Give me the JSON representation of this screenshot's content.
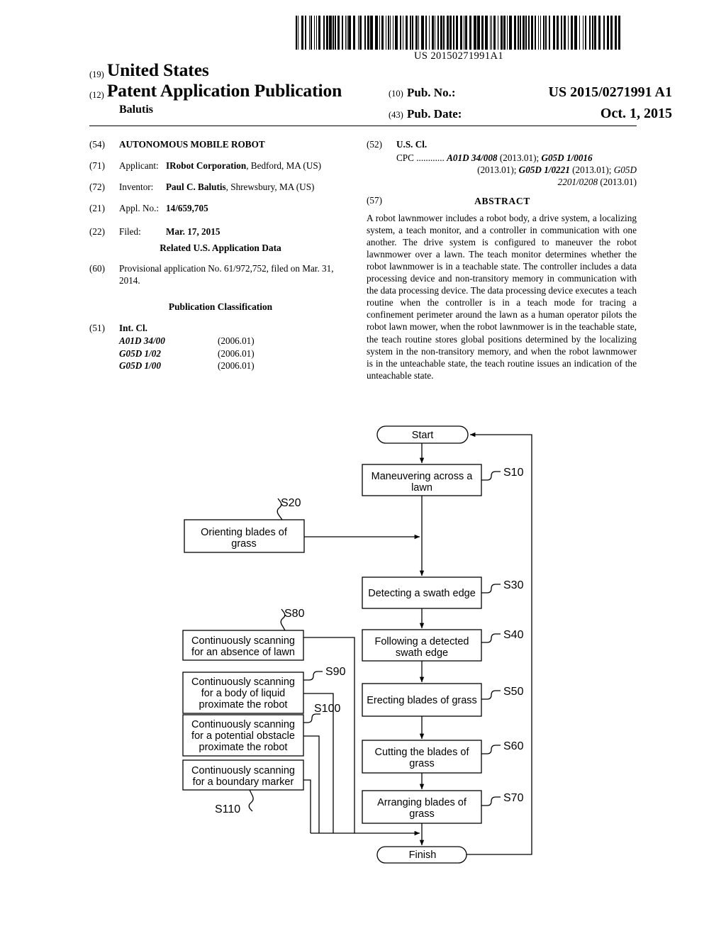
{
  "header": {
    "barcode_number": "US 20150271991A1",
    "code_19": "(19)",
    "country": "United States",
    "code_12": "(12)",
    "doc_type": "Patent Application Publication",
    "author": "Balutis",
    "code_10": "(10)",
    "pub_no_label": "Pub. No.:",
    "pub_no_value": "US 2015/0271991 A1",
    "code_43": "(43)",
    "pub_date_label": "Pub. Date:",
    "pub_date_value": "Oct. 1, 2015"
  },
  "left_column": {
    "title_code": "(54)",
    "title": "AUTONOMOUS MOBILE ROBOT",
    "applicant_code": "(71)",
    "applicant_label": "Applicant:",
    "applicant_name": "IRobot Corporation",
    "applicant_rest": ", Bedford, MA (US)",
    "inventor_code": "(72)",
    "inventor_label": "Inventor:",
    "inventor_name": "Paul C. Balutis",
    "inventor_rest": ", Shrewsbury, MA (US)",
    "appl_no_code": "(21)",
    "appl_no_label": "Appl. No.:",
    "appl_no_value": "14/659,705",
    "filed_code": "(22)",
    "filed_label": "Filed:",
    "filed_value": "Mar. 17, 2015",
    "related_heading": "Related U.S. Application Data",
    "provisional_code": "(60)",
    "provisional_text": "Provisional application No. 61/972,752, filed on Mar. 31, 2014.",
    "classification_heading": "Publication Classification",
    "intcl_code": "(51)",
    "intcl_label": "Int. Cl.",
    "intcl_rows": [
      {
        "classification": "A01D 34/00",
        "version": "(2006.01)"
      },
      {
        "classification": "G05D 1/02",
        "version": "(2006.01)"
      },
      {
        "classification": "G05D 1/00",
        "version": "(2006.01)"
      }
    ]
  },
  "right_column": {
    "uscl_code": "(52)",
    "uscl_label": "U.S. Cl.",
    "cpc_prefix": "CPC ............",
    "cpc_line1_a": "A01D 34/008",
    "cpc_line1_b": " (2013.01); ",
    "cpc_line1_c": "G05D 1/0016",
    "cpc_line2_a": "(2013.01); ",
    "cpc_line2_b": "G05D 1/0221",
    "cpc_line2_c": " (2013.01); ",
    "cpc_line2_d": "G05D",
    "cpc_line3_a": "2201/0208",
    "cpc_line3_b": " (2013.01)",
    "abstract_code": "(57)",
    "abstract_title": "ABSTRACT",
    "abstract_text": "A robot lawnmower includes a robot body, a drive system, a localizing system, a teach monitor, and a controller in communication with one another. The drive system is configured to maneuver the robot lawnmower over a lawn. The teach monitor determines whether the robot lawnmower is in a teachable state. The controller includes a data processing device and non-transitory memory in communication with the data processing device. The data processing device executes a teach routine when the controller is in a teach mode for tracing a confinement perimeter around the lawn as a human operator pilots the robot lawn mower, when the robot lawnmower is in the teachable state, the teach routine stores global positions determined by the localizing system in the non-transitory memory, and when the robot lawnmower is in the unteachable state, the teach routine issues an indication of the unteachable state."
  },
  "flowchart": {
    "start_label": "Start",
    "finish_label": "Finish",
    "nodes": [
      {
        "id": "S10",
        "tag": "S10",
        "lines": [
          "Maneuvering across a",
          "lawn"
        ]
      },
      {
        "id": "S20",
        "tag": "S20",
        "lines": [
          "Orienting blades of",
          "grass"
        ]
      },
      {
        "id": "S30",
        "tag": "S30",
        "lines": [
          "Detecting a swath edge"
        ]
      },
      {
        "id": "S40",
        "tag": "S40",
        "lines": [
          "Following a detected",
          "swath edge"
        ]
      },
      {
        "id": "S50",
        "tag": "S50",
        "lines": [
          "Erecting blades of grass"
        ]
      },
      {
        "id": "S60",
        "tag": "S60",
        "lines": [
          "Cutting the blades of",
          "grass"
        ]
      },
      {
        "id": "S70",
        "tag": "S70",
        "lines": [
          "Arranging blades of",
          "grass"
        ]
      },
      {
        "id": "S80",
        "tag": "S80",
        "lines": [
          "Continuously scanning",
          "for an absence of lawn"
        ]
      },
      {
        "id": "S90",
        "tag": "S90",
        "lines": [
          "Continuously scanning",
          "for a body of liquid",
          "proximate the robot"
        ]
      },
      {
        "id": "S100",
        "tag": "S100",
        "lines": [
          "Continuously scanning",
          "for a potential obstacle",
          "proximate the robot"
        ]
      },
      {
        "id": "S110",
        "tag": "S110",
        "lines": [
          "Continuously scanning",
          "for a boundary marker"
        ]
      }
    ]
  }
}
